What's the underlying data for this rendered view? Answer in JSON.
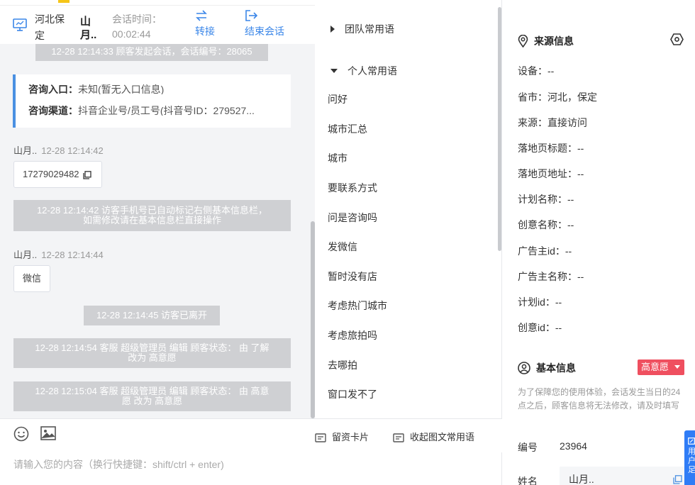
{
  "chat_header": {
    "location": "河北保定",
    "name": "山月..",
    "session_time_label": "会话时间：",
    "session_time": "00:02:44",
    "transfer_label": "转接",
    "end_label": "结束会话"
  },
  "messages": {
    "sys_start": "12-28 12:14:33 顾客发起会话，会话编号：28065",
    "entry_label": "咨询入口：",
    "entry_value": "未知(暂无入口信息)",
    "channel_label": "咨询渠道：",
    "channel_value": "抖音企业号/员工号(抖音号ID：279527...",
    "user1_name": "山月..",
    "user1_time": "12-28 12:14:42",
    "user1_text": "17279029482",
    "sys_phone_1": "12-28 12:14:42 访客手机号已自动标记右侧基本信息栏，",
    "sys_phone_2": "如需修改请在基本信息栏直接操作",
    "user2_name": "山月..",
    "user2_time": "12-28 12:14:44",
    "user2_text": "微信",
    "sys_left": "12-28 12:14:45 访客已离开",
    "sys_edit1_1": "12-28 12:14:54 客服 超级管理员 编辑 顾客状态： 由 了解",
    "sys_edit1_2": "改为 高意愿",
    "sys_edit2_1": "12-28 12:15:04 客服 超级管理员 编辑 顾客状态： 由 高意",
    "sys_edit2_2": "愿 改为 高意愿"
  },
  "composer": {
    "placeholder": "请输入您的内容（换行快捷键：shift/ctrl + enter)",
    "emoji_icon": "smile-icon",
    "image_icon": "image-icon"
  },
  "phrases": {
    "team_group": "团队常用语",
    "personal_group": "个人常用语",
    "items": [
      "问好",
      "城市汇总",
      "城市",
      "要联系方式",
      "问是咨询吗",
      "发微信",
      "暂时没有店",
      "考虑热门城市",
      "考虑旅拍吗",
      "去哪拍",
      "窗口发不了"
    ],
    "footer_card": "留资卡片",
    "footer_collapse": "收起图文常用语"
  },
  "source_info": {
    "title": "来源信息",
    "rows": [
      "设备：--",
      "省市：河北，保定",
      "来源：直接访问",
      "落地页标题：--",
      "落地页地址：--",
      "计划名称：--",
      "创意名称：--",
      "广告主id：--",
      "广告主名称：--",
      "计划id：--",
      "创意id：--"
    ]
  },
  "basic_info": {
    "title": "基本信息",
    "intent": "高意愿",
    "notice": "为了保障您的使用体验，会话发生当日的24点之后，顾客信息将无法修改，请及时填写",
    "id_label": "编号",
    "id_value": "23964",
    "name_label": "姓名",
    "name_value": "山月..",
    "side_tab": "用户足"
  },
  "colors": {
    "accent": "#3a86e8",
    "badge": "#ef4f5f",
    "system_msg": "#cfd0d3"
  }
}
